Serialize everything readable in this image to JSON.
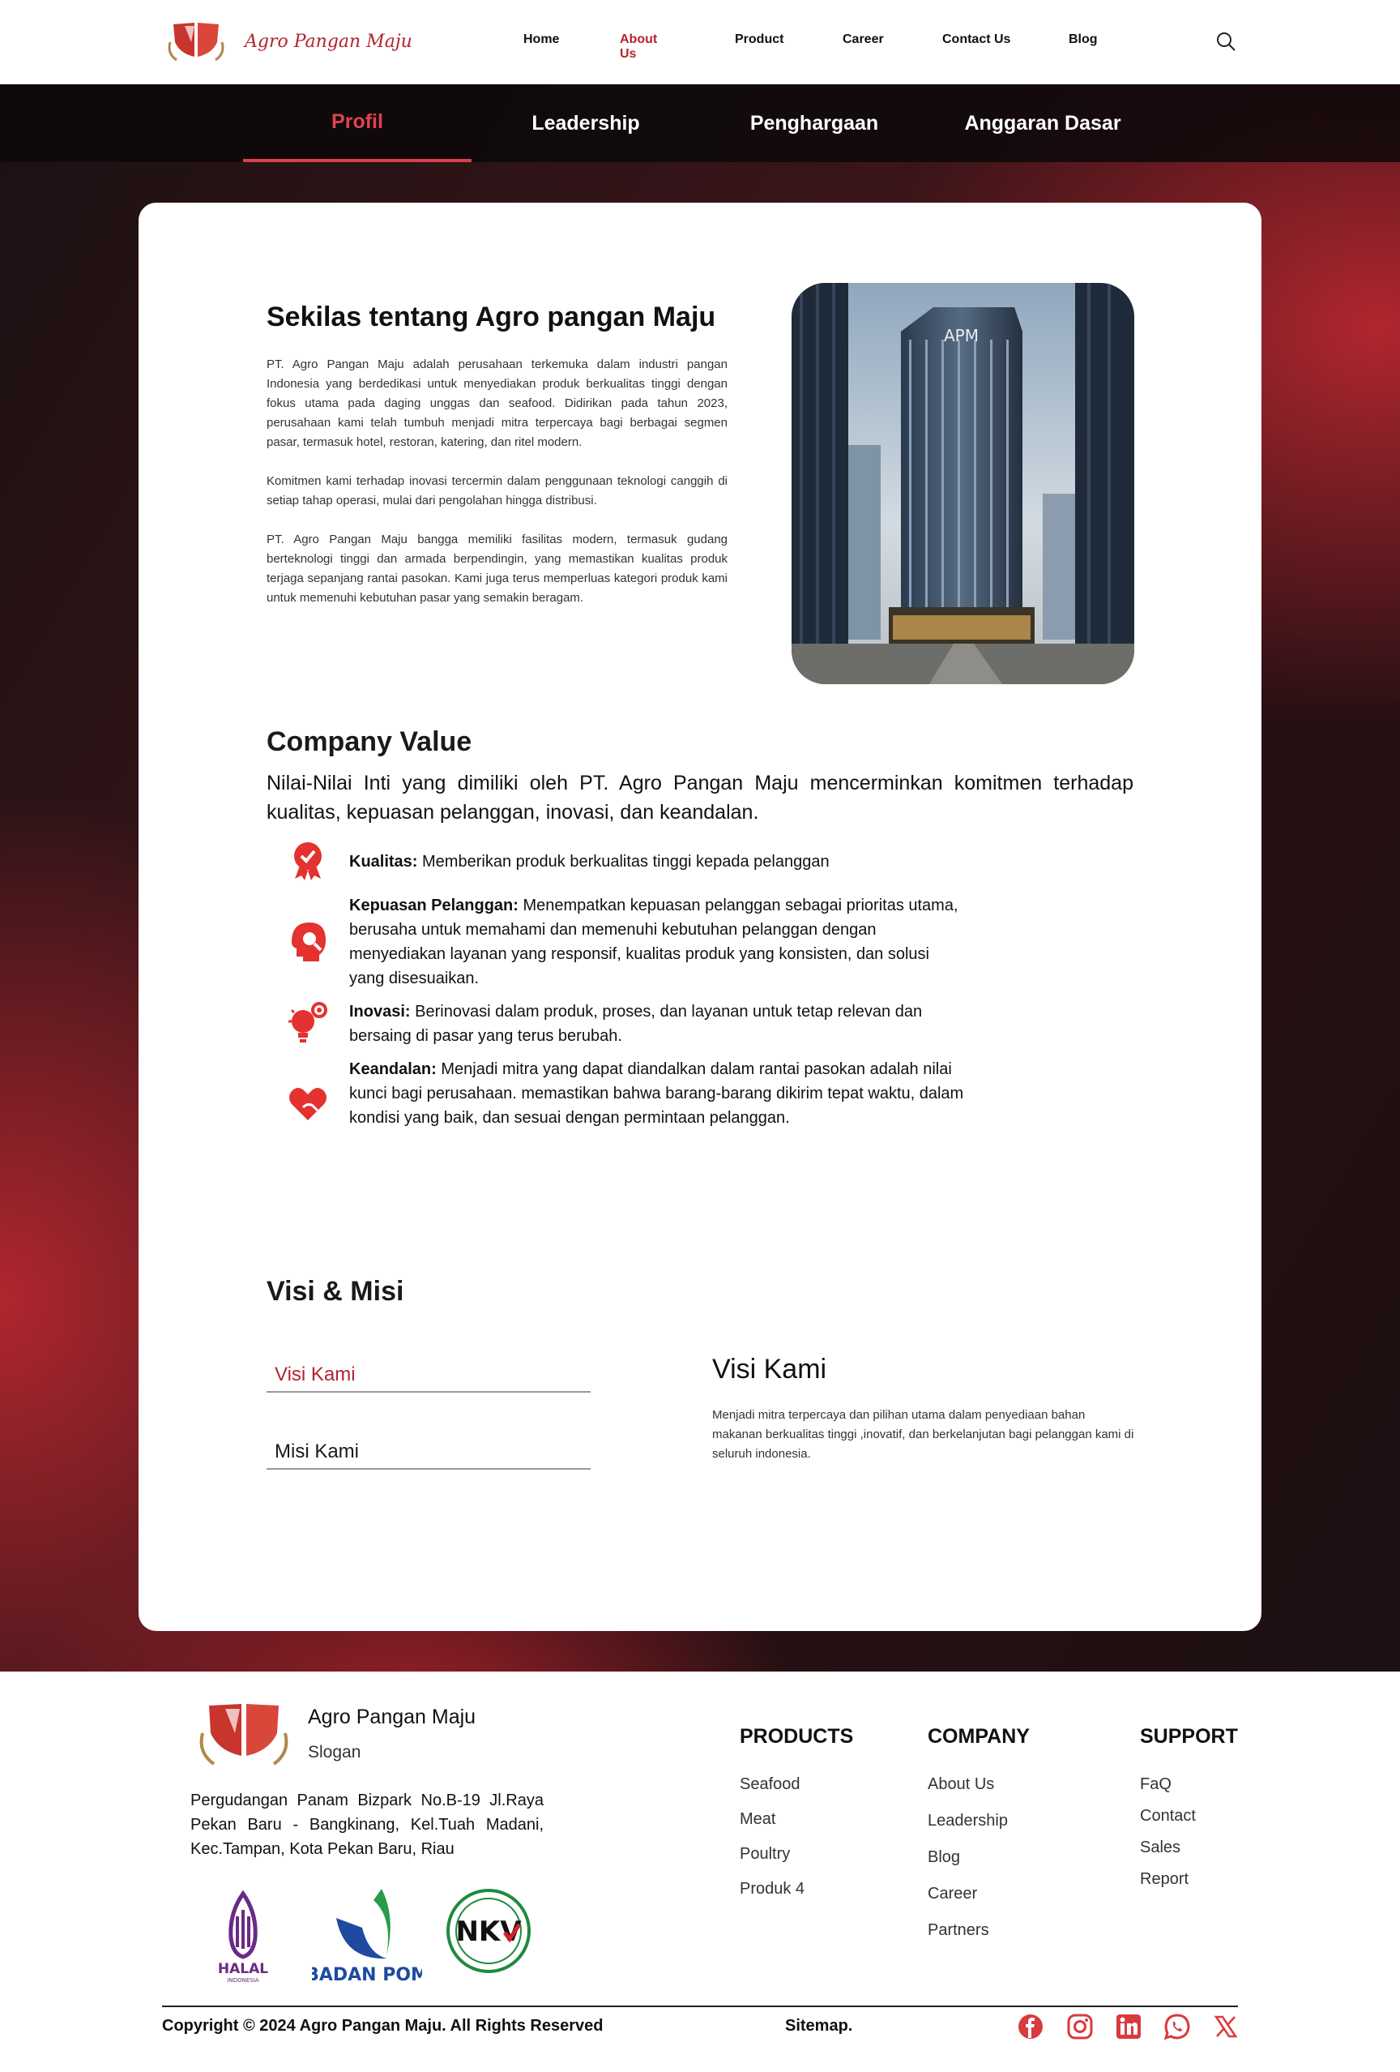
{
  "nav": {
    "brand": "Agro Pangan Maju",
    "items": [
      {
        "label": "Home"
      },
      {
        "label": "About Us"
      },
      {
        "label": "Product"
      },
      {
        "label": "Career"
      },
      {
        "label": "Contact Us"
      },
      {
        "label": "Blog"
      }
    ],
    "active": "About Us"
  },
  "tabs": [
    {
      "label": "Profil"
    },
    {
      "label": "Leadership"
    },
    {
      "label": "Penghargaan"
    },
    {
      "label": "Anggaran Dasar"
    }
  ],
  "about": {
    "title": "Sekilas tentang Agro pangan Maju",
    "paragraphs": [
      "PT. Agro Pangan Maju adalah perusahaan terkemuka dalam industri pangan Indonesia yang berdedikasi untuk menyediakan produk berkualitas tinggi dengan fokus utama pada daging unggas dan seafood. Didirikan pada tahun 2023, perusahaan kami telah tumbuh menjadi mitra terpercaya bagi berbagai segmen pasar, termasuk hotel, restoran, katering, dan ritel modern.",
      "Komitmen kami terhadap inovasi tercermin dalam penggunaan teknologi canggih di setiap tahap operasi, mulai dari pengolahan hingga distribusi.",
      "PT. Agro Pangan Maju bangga memiliki fasilitas modern, termasuk gudang berteknologi tinggi dan armada berpendingin, yang memastikan kualitas produk terjaga sepanjang rantai pasokan. Kami juga terus memperluas kategori produk kami untuk memenuhi kebutuhan pasar yang semakin beragam."
    ],
    "building_sign": "APM"
  },
  "values": {
    "title": "Company Value",
    "intro": "Nilai-Nilai Inti yang dimiliki oleh PT. Agro Pangan Maju mencerminkan komitmen terhadap kualitas, kepuasan pelanggan, inovasi, dan keandalan.",
    "items": [
      {
        "icon": "award-badge-icon",
        "label": "Kualitas:",
        "text": " Memberikan produk berkualitas tinggi kepada pelanggan"
      },
      {
        "icon": "customer-head-icon",
        "label": "Kepuasan Pelanggan:",
        "text": " Menempatkan kepuasan pelanggan sebagai prioritas utama, berusaha untuk memahami dan memenuhi kebutuhan pelanggan dengan menyediakan layanan yang responsif, kualitas produk yang konsisten, dan solusi yang disesuaikan."
      },
      {
        "icon": "lightbulb-gear-icon",
        "label": "Inovasi:",
        "text": " Berinovasi dalam produk, proses, dan layanan untuk tetap relevan dan bersaing di pasar yang terus berubah."
      },
      {
        "icon": "heart-hand-icon",
        "label": "Keandalan:",
        "text": "  Menjadi mitra yang dapat diandalkan dalam rantai pasokan adalah nilai kunci bagi perusahaan. memastikan bahwa barang-barang dikirim tepat waktu, dalam kondisi yang baik, dan sesuai dengan permintaan pelanggan."
      }
    ],
    "accent": "#e3322f"
  },
  "vision": {
    "title": "Visi & Misi",
    "tab_visi": "Visi  Kami",
    "tab_misi": "Misi  Kami",
    "heading": "Visi Kami",
    "body": "Menjadi mitra terpercaya dan pilihan utama dalam  penyediaan bahan makanan berkualitas tinggi ,inovatif, dan berkelanjutan bagi pelanggan kami di seluruh indonesia."
  },
  "footer": {
    "name": "Agro Pangan Maju",
    "slogan": "Slogan",
    "address": "Pergudangan Panam Bizpark No.B-19 Jl.Raya Pekan Baru - Bangkinang, Kel.Tuah Madani, Kec.Tampan, Kota Pekan Baru, Riau",
    "certs": {
      "halal_main": "HALAL",
      "halal_sub": "INDONESIA",
      "pom": "BADAN POM",
      "nkv": "NKV"
    },
    "products": {
      "title": "PRODUCTS",
      "links": [
        "Seafood",
        "Meat",
        "Poultry",
        "Produk 4"
      ]
    },
    "company": {
      "title": "COMPANY",
      "links": [
        "About Us",
        "Leadership",
        "Blog",
        "Career",
        "Partners"
      ]
    },
    "support": {
      "title": "SUPPORT",
      "links": [
        "FaQ",
        "Contact",
        "Sales",
        "Report"
      ]
    },
    "copyright": "Copyright © 2024 Agro Pangan Maju. All Rights Reserved",
    "sitemap": "Sitemap.",
    "social": [
      "facebook-icon",
      "instagram-icon",
      "linkedin-icon",
      "whatsapp-icon",
      "x-icon"
    ]
  },
  "colors": {
    "brand_red": "#b3242e",
    "active_tab": "#e0434d",
    "icon_red": "#e3322f"
  }
}
